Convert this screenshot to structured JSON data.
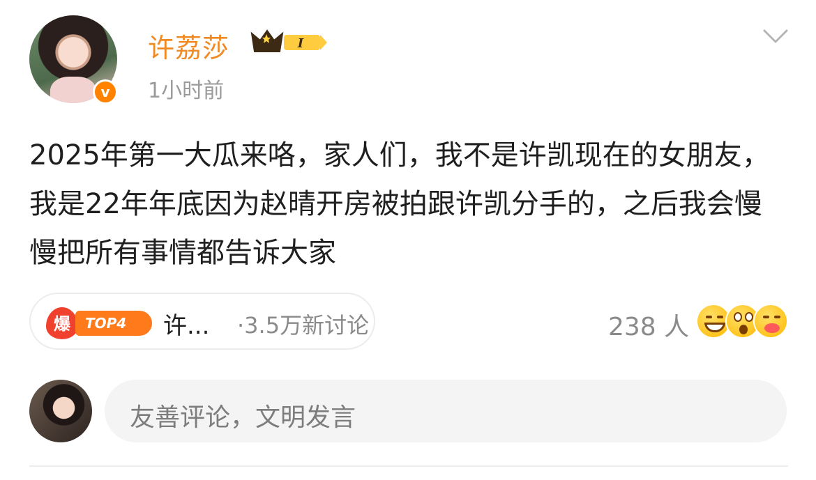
{
  "post": {
    "author": "许荔莎",
    "vip_level": "I",
    "timestamp": "1小时前",
    "verified_mark": "v",
    "content": "2025年第一大瓜来咯，家人们，我不是许凯现在的女朋友，我是22年年底因为赵晴开房被拍跟许凯分手的，之后我会慢慢把所有事情都告诉大家"
  },
  "topic": {
    "hot_label": "爆",
    "rank_label": "TOP4",
    "title": "许...",
    "discussion_count": "·3.5万新讨论"
  },
  "reactions": {
    "count": "238 人",
    "emoji_names": [
      "grinning-emoji",
      "shocked-emoji",
      "kissing-emoji"
    ]
  },
  "comment_box": {
    "placeholder": "友善评论，文明发言"
  },
  "colors": {
    "username": "#f08a24",
    "verified": "#ff8200",
    "hot": "#f0402e",
    "rank": "#ff7a1a",
    "muted": "#9a9a9a"
  },
  "icons": {
    "menu": "chevron-down-icon",
    "badge": "crown-vip-icon"
  }
}
